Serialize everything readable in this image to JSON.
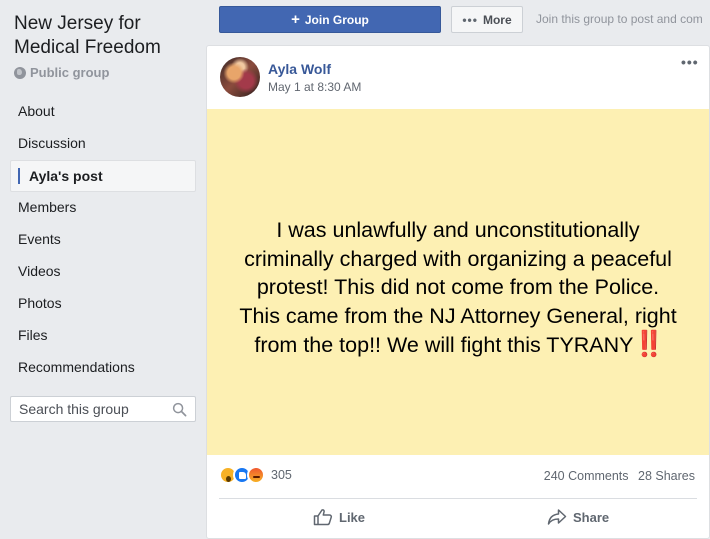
{
  "group": {
    "title": "New Jersey for Medical Freedom",
    "privacy": "Public group"
  },
  "nav": {
    "items": [
      {
        "label": "About"
      },
      {
        "label": "Discussion"
      },
      {
        "label": "Ayla's post",
        "active": true
      },
      {
        "label": "Members"
      },
      {
        "label": "Events"
      },
      {
        "label": "Videos"
      },
      {
        "label": "Photos"
      },
      {
        "label": "Files"
      },
      {
        "label": "Recommendations"
      }
    ]
  },
  "search": {
    "placeholder": "Search this group",
    "icon": "magnifier-icon"
  },
  "header": {
    "join_label": "Join Group",
    "more_label": "More",
    "join_hint": "Join this group to post and com"
  },
  "post": {
    "author": "Ayla Wolf",
    "time": "May 1 at 8:30 AM",
    "text": "I was unlawfully and unconstitutionally criminally charged with organizing a peaceful protest! This did not come from the Police. This came from the NJ Attorney General, right from the top!! We will fight this TYRANY",
    "emoji": "‼️",
    "background_color": "#fdf0b3",
    "reactions": [
      "wow",
      "like",
      "angry"
    ],
    "reaction_count": "305",
    "comments": "240 Comments",
    "shares": "28 Shares",
    "actions": {
      "like": "Like",
      "share": "Share"
    }
  },
  "colors": {
    "accent": "#4267b2",
    "link": "#385898",
    "page_bg": "#e9ebee"
  }
}
